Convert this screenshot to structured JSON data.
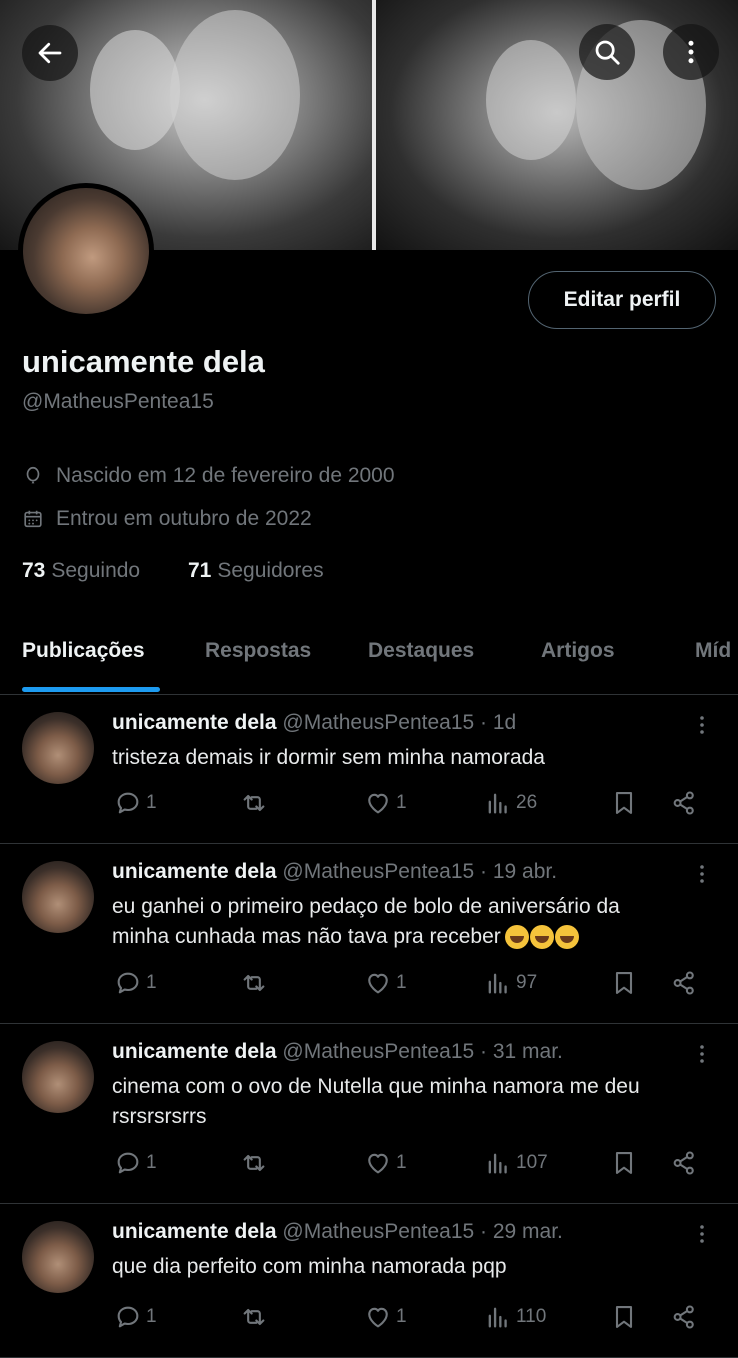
{
  "colors": {
    "background": "#000000",
    "accent": "#1d9bf0",
    "muted": "#71767b",
    "text": "#e7e9ea",
    "border": "#2f3336"
  },
  "header": {
    "back_icon": "arrow-left-icon",
    "search_icon": "search-icon",
    "more_icon": "more-vertical-icon"
  },
  "profile": {
    "display_name": "unicamente dela",
    "handle": "@MatheusPentea15",
    "edit_button": "Editar perfil",
    "birth": "Nascido em 12 de fevereiro de 2000",
    "joined": "Entrou em outubro de 2022",
    "following_count": "73",
    "following_label": "Seguindo",
    "followers_count": "71",
    "followers_label": "Seguidores"
  },
  "tabs": [
    {
      "label": "Publicações",
      "active": true
    },
    {
      "label": "Respostas",
      "active": false
    },
    {
      "label": "Destaques",
      "active": false
    },
    {
      "label": "Artigos",
      "active": false
    },
    {
      "label": "Míd",
      "active": false
    }
  ],
  "posts": [
    {
      "name": "unicamente dela",
      "handle": "@MatheusPentea15",
      "time": "· 1d",
      "lines": [
        "tristeza demais ir dormir sem minha namorada"
      ],
      "emoji_count": 0,
      "replies": "1",
      "likes": "1",
      "views": "26"
    },
    {
      "name": "unicamente dela",
      "handle": "@MatheusPentea15",
      "time": "· 19 abr.",
      "lines": [
        "eu ganhei o primeiro pedaço de bolo de aniversário da",
        "minha cunhada mas não tava pra receber"
      ],
      "emoji_count": 3,
      "replies": "1",
      "likes": "1",
      "views": "97"
    },
    {
      "name": "unicamente dela",
      "handle": "@MatheusPentea15",
      "time": "· 31 mar.",
      "lines": [
        "cinema com o ovo de Nutella que minha namora me deu",
        "rsrsrsrsrrs"
      ],
      "emoji_count": 0,
      "replies": "1",
      "likes": "1",
      "views": "107"
    },
    {
      "name": "unicamente dela",
      "handle": "@MatheusPentea15",
      "time": "· 29 mar.",
      "lines": [
        "que dia perfeito com minha namorada pqp"
      ],
      "emoji_count": 0,
      "replies": "1",
      "likes": "1",
      "views": "110"
    }
  ]
}
